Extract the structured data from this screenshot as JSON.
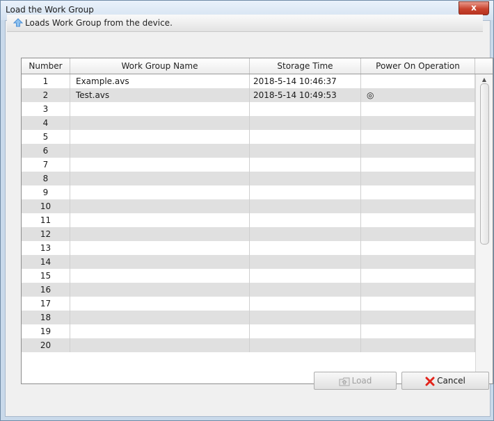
{
  "window": {
    "title": "Load the Work Group",
    "close_label": "x"
  },
  "info": {
    "text": "Loads Work Group from the device."
  },
  "table": {
    "columns": [
      "Number",
      "Work Group Name",
      "Storage Time",
      "Power On Operation"
    ],
    "rows": [
      {
        "number": "1",
        "name": "Example.avs",
        "time": "2018-5-14 10:46:37",
        "power": ""
      },
      {
        "number": "2",
        "name": "Test.avs",
        "time": "2018-5-14 10:49:53",
        "power": "◎"
      },
      {
        "number": "3",
        "name": "",
        "time": "",
        "power": ""
      },
      {
        "number": "4",
        "name": "",
        "time": "",
        "power": ""
      },
      {
        "number": "5",
        "name": "",
        "time": "",
        "power": ""
      },
      {
        "number": "6",
        "name": "",
        "time": "",
        "power": ""
      },
      {
        "number": "7",
        "name": "",
        "time": "",
        "power": ""
      },
      {
        "number": "8",
        "name": "",
        "time": "",
        "power": ""
      },
      {
        "number": "9",
        "name": "",
        "time": "",
        "power": ""
      },
      {
        "number": "10",
        "name": "",
        "time": "",
        "power": ""
      },
      {
        "number": "11",
        "name": "",
        "time": "",
        "power": ""
      },
      {
        "number": "12",
        "name": "",
        "time": "",
        "power": ""
      },
      {
        "number": "13",
        "name": "",
        "time": "",
        "power": ""
      },
      {
        "number": "14",
        "name": "",
        "time": "",
        "power": ""
      },
      {
        "number": "15",
        "name": "",
        "time": "",
        "power": ""
      },
      {
        "number": "16",
        "name": "",
        "time": "",
        "power": ""
      },
      {
        "number": "17",
        "name": "",
        "time": "",
        "power": ""
      },
      {
        "number": "18",
        "name": "",
        "time": "",
        "power": ""
      },
      {
        "number": "19",
        "name": "",
        "time": "",
        "power": ""
      },
      {
        "number": "20",
        "name": "",
        "time": "",
        "power": ""
      }
    ]
  },
  "buttons": {
    "load": "Load",
    "cancel": "Cancel"
  },
  "icons": {
    "info": "upload-arrow-icon",
    "load": "load-folder-icon",
    "cancel": "red-x-icon",
    "close": "close-icon"
  },
  "colors": {
    "close_red": "#c9432e",
    "cancel_x": "#e2231a",
    "upload_arrow": "#4a8fd6"
  }
}
